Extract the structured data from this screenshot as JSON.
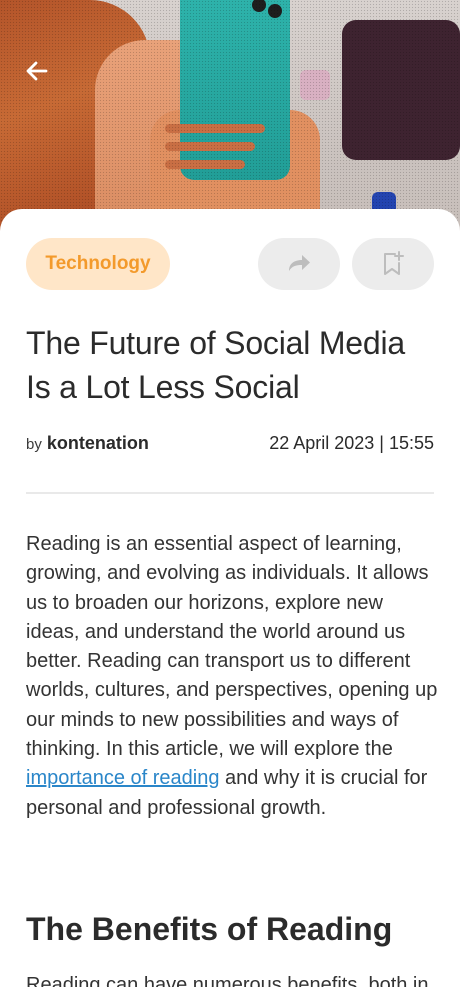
{
  "hero": {
    "image_alt": "Illustration of a woman holding a smartphone"
  },
  "nav": {
    "back_icon": "arrow-left-icon"
  },
  "article": {
    "category": "Technology",
    "share_icon": "share-arrow-icon",
    "bookmark_icon": "bookmark-add-icon",
    "title": "The Future of Social Media Is a Lot Less Social",
    "by_label": "by",
    "author": "kontenation",
    "date": "22 April 2023 | 15:55",
    "body_before_link": "Reading is an essential aspect of learning, growing, and evolving as individuals. It allows us to broaden our horizons, explore new ideas, and understand the world around us better. Reading can transport us to different worlds, cultures, and perspectives, opening up our minds to new possibilities and ways of thinking. In this article, we will explore the ",
    "body_link": "importance of reading",
    "body_after_link": " and why it is crucial for personal and professional growth.",
    "section_heading": "The Benefits of Reading",
    "next_paragraph_start": "Reading can have numerous benefits, both in"
  },
  "colors": {
    "category_bg": "#ffe6c8",
    "category_text": "#f39a2c",
    "link": "#2a86c9",
    "icon_button_bg": "#ececec"
  }
}
